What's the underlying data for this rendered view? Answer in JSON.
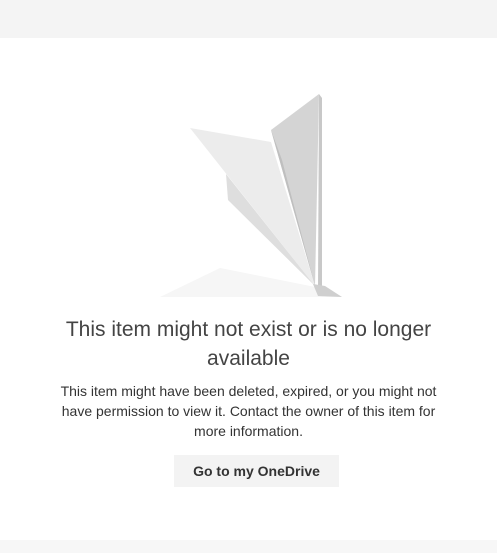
{
  "error": {
    "title": "This item might not exist or is no longer available",
    "message": "This item might have been deleted, expired, or you might not have permission to view it. Contact the owner of this item for more information.",
    "illustration_icon": "paper-plane-icon"
  },
  "actions": {
    "go_to_onedrive_label": "Go to my OneDrive"
  }
}
